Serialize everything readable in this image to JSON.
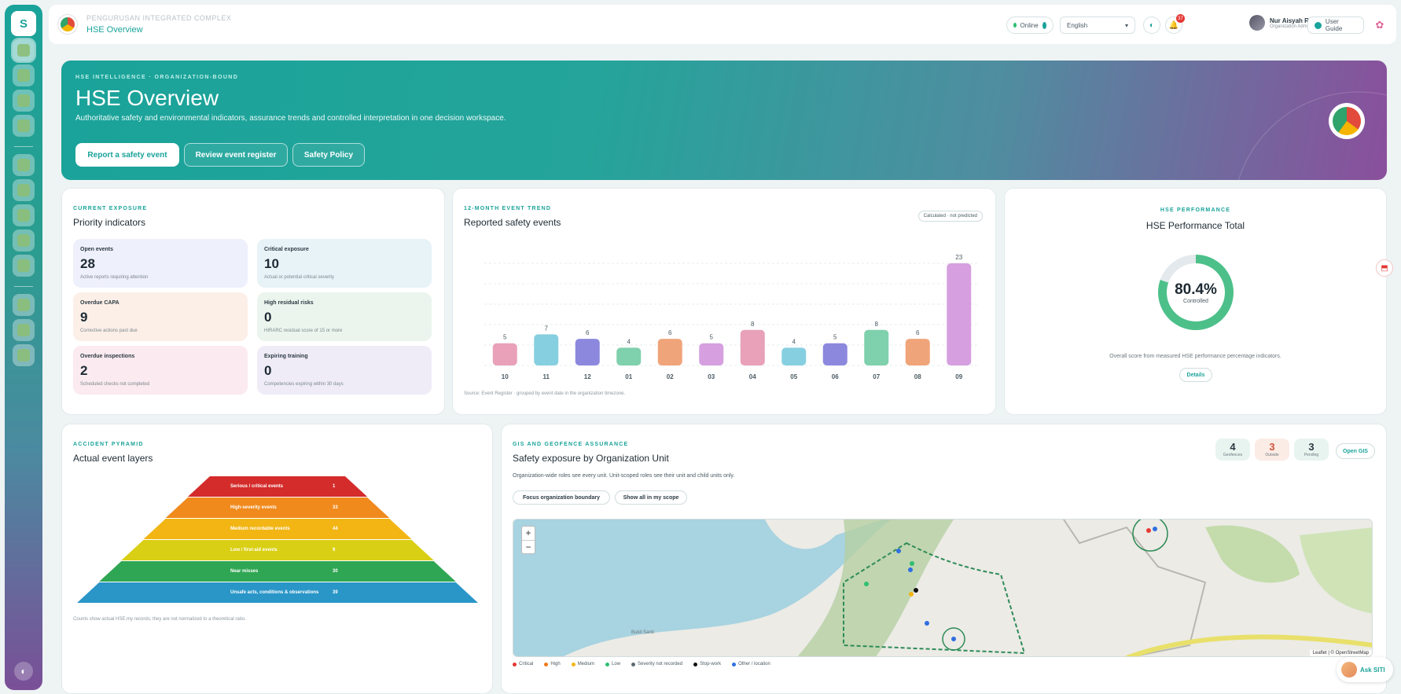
{
  "topbar": {
    "org_name": "PENGURUSAN INTEGRATED COMPLEX",
    "page_title": "HSE Overview",
    "status": "Online",
    "language": "English",
    "notifications": "37",
    "user_name": "Nur Aisyah Rahman",
    "user_role": "Organization Administrator",
    "guide": "User Guide"
  },
  "sidebar": {
    "logo_text": "S",
    "items": [
      "dashboard",
      "register",
      "inspections",
      "training",
      "incidents",
      "tools",
      "environment",
      "risk",
      "workflow",
      "people",
      "reports",
      "documents"
    ]
  },
  "hero": {
    "eyebrow": "HSE INTELLIGENCE · ORGANIZATION-BOUND",
    "title": "HSE Overview",
    "subtitle": "Authoritative safety and environmental indicators, assurance trends and controlled interpretation in one decision workspace.",
    "btn_report": "Report a safety event",
    "btn_review": "Review event register",
    "btn_policy": "Safety Policy"
  },
  "exposure": {
    "eyebrow": "CURRENT EXPOSURE",
    "title": "Priority indicators",
    "tiles": [
      {
        "label": "Open events",
        "value": "28",
        "note": "Active reports requiring attention",
        "bg": "#eef0fb"
      },
      {
        "label": "Critical exposure",
        "value": "10",
        "note": "Actual or potential critical severity",
        "bg": "#e8f3f8"
      },
      {
        "label": "Overdue CAPA",
        "value": "9",
        "note": "Corrective actions past due",
        "bg": "#fcefe8"
      },
      {
        "label": "High residual risks",
        "value": "0",
        "note": "HIRARC residual score of 15 or more",
        "bg": "#ebf5ee"
      },
      {
        "label": "Overdue inspections",
        "value": "2",
        "note": "Scheduled checks not completed",
        "bg": "#fbeaef"
      },
      {
        "label": "Expiring training",
        "value": "0",
        "note": "Competencies expiring within 30 days",
        "bg": "#efecf8"
      }
    ]
  },
  "trend": {
    "eyebrow": "12-MONTH EVENT TREND",
    "title": "Reported safety events",
    "pill": "Calculated · not predicted",
    "source": "Source: Event Register · grouped by event date in the organization timezone."
  },
  "chart_data": {
    "type": "bar",
    "categories": [
      "10",
      "11",
      "12",
      "01",
      "02",
      "03",
      "04",
      "05",
      "06",
      "07",
      "08",
      "09"
    ],
    "values": [
      5,
      7,
      6,
      4,
      6,
      5,
      8,
      4,
      5,
      8,
      6,
      23
    ],
    "colors": [
      "#e8a1b8",
      "#86cfe0",
      "#8c88de",
      "#7fd0ac",
      "#f0a47a",
      "#d69fe0",
      "#e8a1b8",
      "#86cfe0",
      "#8c88de",
      "#7fd0ac",
      "#f0a47a",
      "#d69fe0"
    ],
    "ylim": [
      0,
      23
    ],
    "grid": true
  },
  "performance": {
    "eyebrow": "HSE PERFORMANCE",
    "title": "HSE Performance Total",
    "value_fraction": 0.804,
    "value_text": "80.4%",
    "status": "Controlled",
    "note": "Overall score from measured HSE performance percentage indicators.",
    "details": "Details"
  },
  "pyramid": {
    "eyebrow": "ACCIDENT PYRAMID",
    "title": "Actual event layers",
    "note": "Counts show actual HSE.my records; they are not normalized to a theoretical ratio.",
    "layers": [
      {
        "label": "Serious / critical events",
        "value": "1",
        "color": "#d42b2b"
      },
      {
        "label": "High-severity events",
        "value": "33",
        "color": "#f08a1c"
      },
      {
        "label": "Medium recordable events",
        "value": "44",
        "color": "#f2b514"
      },
      {
        "label": "Low / first-aid events",
        "value": "9",
        "color": "#d9cf14"
      },
      {
        "label": "Near misses",
        "value": "30",
        "color": "#2fa653"
      },
      {
        "label": "Unsafe acts, conditions & observations",
        "value": "39",
        "color": "#2a96c8"
      }
    ]
  },
  "gis": {
    "eyebrow": "GIS AND GEOFENCE ASSURANCE",
    "title": "Safety exposure by Organization Unit",
    "subtitle": "Organization-wide roles see every unit. Unit-scoped roles see their unit and child units only.",
    "btn_focus": "Focus organization boundary",
    "btn_show": "Show all in my scope",
    "stats": [
      {
        "value": "4",
        "label": "Geofences",
        "bg": "#e8f4ef",
        "color": "#2c3a43"
      },
      {
        "value": "3",
        "label": "Outside",
        "bg": "#fbece6",
        "color": "#d2543a"
      },
      {
        "value": "3",
        "label": "Pending",
        "bg": "#e8f4ef",
        "color": "#2c3a43"
      }
    ],
    "open_gis": "Open GIS",
    "map_label": "Bukit Santi",
    "attribution": "Leaflet | © OpenStreetMap",
    "legend": [
      {
        "label": "Critical",
        "color": "#e53935"
      },
      {
        "label": "High",
        "color": "#f07a1c"
      },
      {
        "label": "Medium",
        "color": "#f2b514"
      },
      {
        "label": "Low",
        "color": "#2fbf71"
      },
      {
        "label": "Severity not recorded",
        "color": "#5c6970"
      },
      {
        "label": "Stop-work",
        "color": "#111111"
      },
      {
        "label": "Other / location",
        "color": "#2f6fe0"
      }
    ]
  },
  "assistant": {
    "label": "Ask SITI"
  }
}
